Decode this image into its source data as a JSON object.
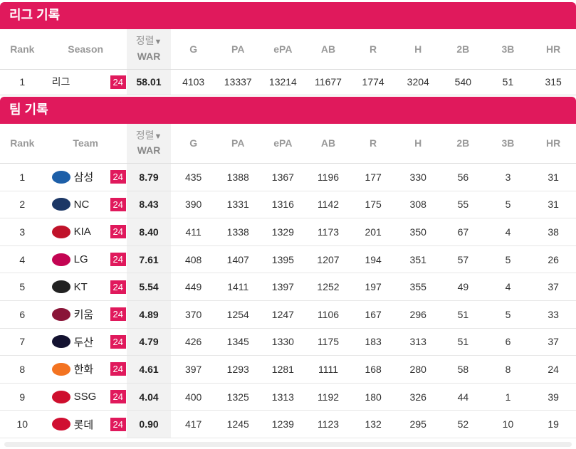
{
  "league": {
    "title": "리그 기록",
    "sort_label": "정렬",
    "columns": [
      "Rank",
      "Season",
      "WAR",
      "G",
      "PA",
      "ePA",
      "AB",
      "R",
      "H",
      "2B",
      "3B",
      "HR"
    ],
    "row": {
      "rank": "1",
      "season": "리그",
      "badge": "24",
      "war": "58.01",
      "stats": [
        "4103",
        "13337",
        "13214",
        "11677",
        "1774",
        "3204",
        "540",
        "51",
        "315"
      ]
    }
  },
  "team": {
    "title": "팀 기록",
    "sort_label": "정렬",
    "columns": [
      "Rank",
      "Team",
      "WAR",
      "G",
      "PA",
      "ePA",
      "AB",
      "R",
      "H",
      "2B",
      "3B",
      "HR"
    ],
    "rows": [
      {
        "rank": "1",
        "name": "삼성",
        "logo": "lions-logo",
        "color": "#1d5fa8",
        "badge": "24",
        "war": "8.79",
        "stats": [
          "435",
          "1388",
          "1367",
          "1196",
          "177",
          "330",
          "56",
          "3",
          "31"
        ]
      },
      {
        "rank": "2",
        "name": "NC",
        "logo": "dinos-logo",
        "color": "#1c3766",
        "badge": "24",
        "war": "8.43",
        "stats": [
          "390",
          "1331",
          "1316",
          "1142",
          "175",
          "308",
          "55",
          "5",
          "31"
        ]
      },
      {
        "rank": "3",
        "name": "KIA",
        "logo": "tigers-logo",
        "color": "#c0122a",
        "badge": "24",
        "war": "8.40",
        "stats": [
          "411",
          "1338",
          "1329",
          "1173",
          "201",
          "350",
          "67",
          "4",
          "38"
        ]
      },
      {
        "rank": "4",
        "name": "LG",
        "logo": "twins-logo",
        "color": "#c30452",
        "badge": "24",
        "war": "7.61",
        "stats": [
          "408",
          "1407",
          "1395",
          "1207",
          "194",
          "351",
          "57",
          "5",
          "26"
        ]
      },
      {
        "rank": "5",
        "name": "KT",
        "logo": "wiz-logo",
        "color": "#222222",
        "badge": "24",
        "war": "5.54",
        "stats": [
          "449",
          "1411",
          "1397",
          "1252",
          "197",
          "355",
          "49",
          "4",
          "37"
        ]
      },
      {
        "rank": "6",
        "name": "키움",
        "logo": "heroes-logo",
        "color": "#8a1538",
        "badge": "24",
        "war": "4.89",
        "stats": [
          "370",
          "1254",
          "1247",
          "1106",
          "167",
          "296",
          "51",
          "5",
          "33"
        ]
      },
      {
        "rank": "7",
        "name": "두산",
        "logo": "bears-logo",
        "color": "#131230",
        "badge": "24",
        "war": "4.79",
        "stats": [
          "426",
          "1345",
          "1330",
          "1175",
          "183",
          "313",
          "51",
          "6",
          "37"
        ]
      },
      {
        "rank": "8",
        "name": "한화",
        "logo": "eagles-logo",
        "color": "#f37321",
        "badge": "24",
        "war": "4.61",
        "stats": [
          "397",
          "1293",
          "1281",
          "1111",
          "168",
          "280",
          "58",
          "8",
          "24"
        ]
      },
      {
        "rank": "9",
        "name": "SSG",
        "logo": "landers-logo",
        "color": "#ce0e2d",
        "badge": "24",
        "war": "4.04",
        "stats": [
          "400",
          "1325",
          "1313",
          "1192",
          "180",
          "326",
          "44",
          "1",
          "39"
        ]
      },
      {
        "rank": "10",
        "name": "롯데",
        "logo": "giants-logo",
        "color": "#d00f31",
        "badge": "24",
        "war": "0.90",
        "stats": [
          "417",
          "1245",
          "1239",
          "1123",
          "132",
          "295",
          "52",
          "10",
          "19"
        ]
      }
    ]
  }
}
